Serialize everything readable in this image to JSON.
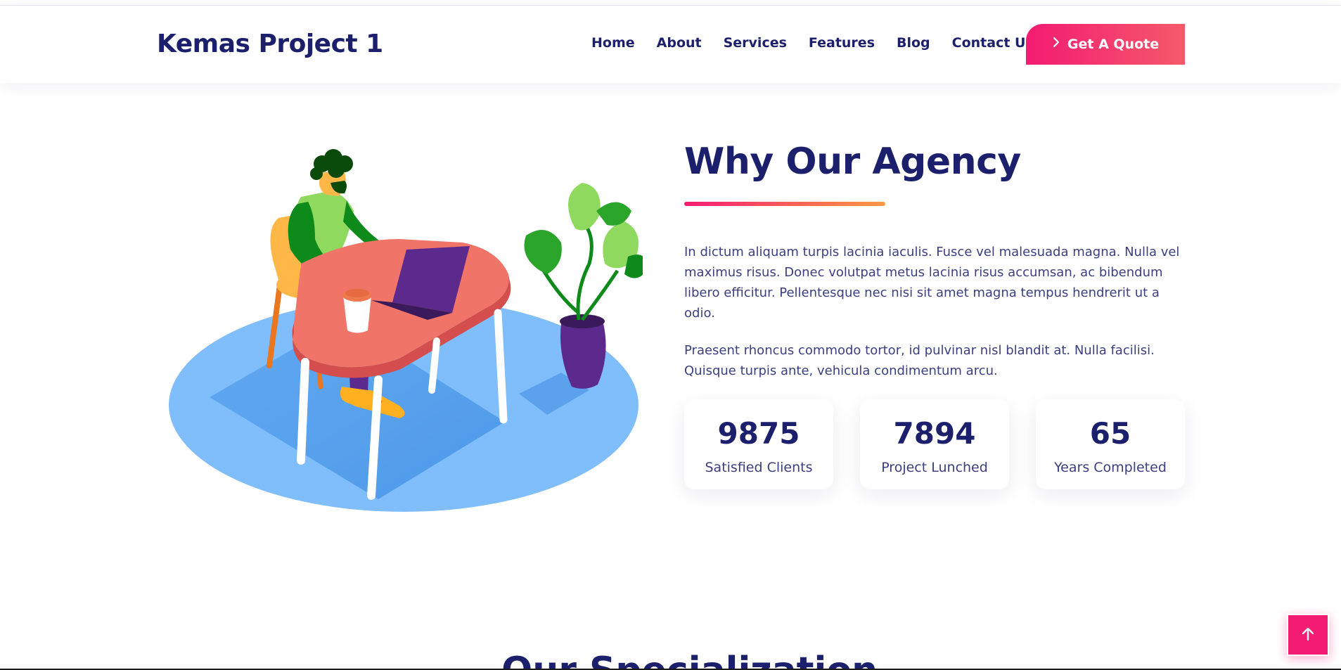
{
  "header": {
    "logo": "Kemas Project 1",
    "nav": [
      "Home",
      "About",
      "Services",
      "Features",
      "Blog",
      "Contact Us"
    ],
    "cta_label": "Get A Quote",
    "cta_icon": "chevron-right-icon"
  },
  "about": {
    "title": "Why Our Agency",
    "paragraphs": [
      "In dictum aliquam turpis lacinia iaculis. Fusce vel malesuada magna. Nulla vel maximus risus. Donec volutpat metus lacinia risus accumsan, ac bibendum libero efficitur. Pellentesque nec nisi sit amet magna tempus hendrerit ut a odio.",
      "Praesent rhoncus commodo tortor, id pulvinar nisl blandit at. Nulla facilisi. Quisque turpis ante, vehicula condimentum arcu."
    ],
    "stats": [
      {
        "value": "9875",
        "label": "Satisfied Clients"
      },
      {
        "value": "7894",
        "label": "Project Lunched"
      },
      {
        "value": "65",
        "label": "Years Completed"
      }
    ]
  },
  "next_section_title": "Our Specialization",
  "scroll_top_icon": "arrow-up-icon",
  "colors": {
    "navy": "#1c1f6b",
    "accent_start": "#f31b72",
    "accent_end": "#ff9a44",
    "floor": "#80bdfb"
  }
}
